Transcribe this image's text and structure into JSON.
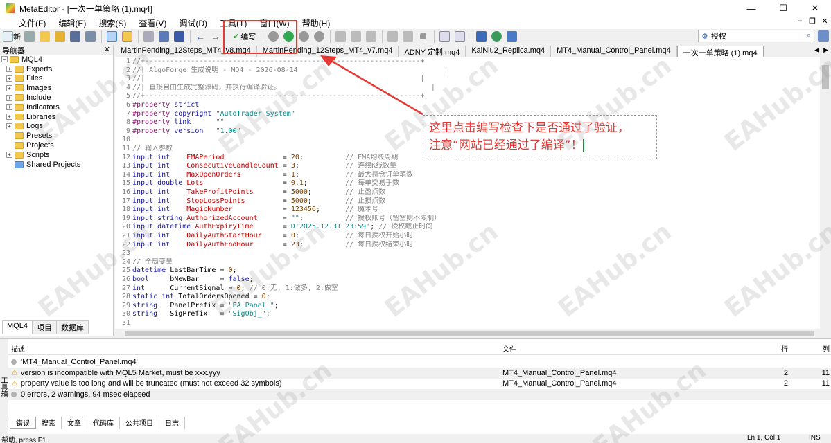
{
  "window": {
    "title": "MetaEditor - [一次一单策略 (1).mq4]",
    "minimize": "—",
    "maximize": "☐",
    "close": "✕"
  },
  "menu": {
    "items": [
      "文件(F)",
      "编辑(E)",
      "搜索(S)",
      "查看(V)",
      "调试(D)",
      "工具(T)",
      "窗口(W)",
      "帮助(H)"
    ]
  },
  "toolbar": {
    "new_label": "新",
    "compile_label": "编写",
    "search_value": "授权"
  },
  "navigator": {
    "title": "导航器",
    "root": "MQL4",
    "items": [
      {
        "label": "Experts",
        "expandable": true
      },
      {
        "label": "Files",
        "expandable": true
      },
      {
        "label": "Images",
        "expandable": true
      },
      {
        "label": "Include",
        "expandable": true
      },
      {
        "label": "Indicators",
        "expandable": true
      },
      {
        "label": "Libraries",
        "expandable": true
      },
      {
        "label": "Logs",
        "expandable": true
      },
      {
        "label": "Presets",
        "expandable": false
      },
      {
        "label": "Projects",
        "expandable": false
      },
      {
        "label": "Scripts",
        "expandable": true
      },
      {
        "label": "Shared Projects",
        "expandable": false
      }
    ],
    "tabs": [
      "MQL4",
      "项目",
      "数据库"
    ]
  },
  "editor_tabs": [
    {
      "label": "MartinPending_12Steps_MT4_v8.mq4",
      "active": false
    },
    {
      "label": "MartinPending_12Steps_MT4_v7.mq4",
      "active": false
    },
    {
      "label": "ADNY 定制.mq4",
      "active": false
    },
    {
      "label": "KaiNiu2_Replica.mq4",
      "active": false
    },
    {
      "label": "MT4_Manual_Control_Panel.mq4",
      "active": false
    },
    {
      "label": "一次一单策略 (1).mq4",
      "active": true
    }
  ],
  "code_lines": [
    [
      [
        "c-comment",
        "//+------------------------------------------------------------------+"
      ]
    ],
    [
      [
        "c-comment",
        "//| AlgoForge 生成说明 - MQ4 - 2026-08-14                                   |"
      ]
    ],
    [
      [
        "c-comment",
        "//|                                                                  |"
      ]
    ],
    [
      [
        "c-comment",
        "//| 直接自由生成完整源码，并执行编译验证。                                    |"
      ]
    ],
    [
      [
        "c-comment",
        "//+------------------------------------------------------------------+"
      ]
    ],
    [
      [
        "c-pp",
        "#property "
      ],
      [
        "c-kw",
        "strict"
      ]
    ],
    [
      [
        "c-pp",
        "#property "
      ],
      [
        "c-kw",
        "copyright "
      ],
      [
        "c-str",
        "\"AutoTrader System\""
      ]
    ],
    [
      [
        "c-pp",
        "#property "
      ],
      [
        "c-kw",
        "link      "
      ],
      [
        "c-str",
        "\"\""
      ]
    ],
    [
      [
        "c-pp",
        "#property "
      ],
      [
        "c-kw",
        "version   "
      ],
      [
        "c-str",
        "\"1.00\""
      ]
    ],
    [
      [
        "c-plain",
        ""
      ]
    ],
    [
      [
        "c-comment",
        "// 输入参数"
      ]
    ],
    [
      [
        "c-kw",
        "input int    "
      ],
      [
        "c-ident",
        "EMAPeriod              "
      ],
      [
        "c-plain",
        "= "
      ],
      [
        "c-num",
        "20"
      ],
      [
        "c-plain",
        ";          "
      ],
      [
        "c-comment",
        "// EMA均线周期"
      ]
    ],
    [
      [
        "c-kw",
        "input int    "
      ],
      [
        "c-ident",
        "ConsecutiveCandleCount "
      ],
      [
        "c-plain",
        "= "
      ],
      [
        "c-num",
        "3"
      ],
      [
        "c-plain",
        ";           "
      ],
      [
        "c-comment",
        "// 连续K线数量"
      ]
    ],
    [
      [
        "c-kw",
        "input int    "
      ],
      [
        "c-ident",
        "MaxOpenOrders          "
      ],
      [
        "c-plain",
        "= "
      ],
      [
        "c-num",
        "1"
      ],
      [
        "c-plain",
        ";           "
      ],
      [
        "c-comment",
        "// 最大持仓订单笔数"
      ]
    ],
    [
      [
        "c-kw",
        "input double "
      ],
      [
        "c-ident",
        "Lots                   "
      ],
      [
        "c-plain",
        "= "
      ],
      [
        "c-num",
        "0.1"
      ],
      [
        "c-plain",
        ";         "
      ],
      [
        "c-comment",
        "// 每单交易手数"
      ]
    ],
    [
      [
        "c-kw",
        "input int    "
      ],
      [
        "c-ident",
        "TakeProfitPoints       "
      ],
      [
        "c-plain",
        "= "
      ],
      [
        "c-num",
        "5000"
      ],
      [
        "c-plain",
        ";        "
      ],
      [
        "c-comment",
        "// 止盈点数"
      ]
    ],
    [
      [
        "c-kw",
        "input int    "
      ],
      [
        "c-ident",
        "StopLossPoints         "
      ],
      [
        "c-plain",
        "= "
      ],
      [
        "c-num",
        "5000"
      ],
      [
        "c-plain",
        ";        "
      ],
      [
        "c-comment",
        "// 止损点数"
      ]
    ],
    [
      [
        "c-kw",
        "input int    "
      ],
      [
        "c-ident",
        "MagicNumber            "
      ],
      [
        "c-plain",
        "= "
      ],
      [
        "c-num",
        "123456"
      ],
      [
        "c-plain",
        ";      "
      ],
      [
        "c-comment",
        "// 魔术号"
      ]
    ],
    [
      [
        "c-kw",
        "input string "
      ],
      [
        "c-ident",
        "AuthorizedAccount      "
      ],
      [
        "c-plain",
        "= "
      ],
      [
        "c-str",
        "\"\""
      ],
      [
        "c-plain",
        ";          "
      ],
      [
        "c-comment",
        "// 授权账号（留空则不限制）"
      ]
    ],
    [
      [
        "c-kw",
        "input datetime "
      ],
      [
        "c-ident",
        "AuthExpiryTime       "
      ],
      [
        "c-plain",
        "= "
      ],
      [
        "c-str",
        "D'2025.12.31 23:59'"
      ],
      [
        "c-plain",
        "; "
      ],
      [
        "c-comment",
        "// 授权截止时间"
      ]
    ],
    [
      [
        "c-kw",
        "input int    "
      ],
      [
        "c-ident",
        "DailyAuthStartHour     "
      ],
      [
        "c-plain",
        "= "
      ],
      [
        "c-num",
        "0"
      ],
      [
        "c-plain",
        ";           "
      ],
      [
        "c-comment",
        "// 每日授权开始小时"
      ]
    ],
    [
      [
        "c-kw",
        "input int    "
      ],
      [
        "c-ident",
        "DailyAuthEndHour       "
      ],
      [
        "c-plain",
        "= "
      ],
      [
        "c-num",
        "23"
      ],
      [
        "c-plain",
        ";          "
      ],
      [
        "c-comment",
        "// 每日授权结束小时"
      ]
    ],
    [
      [
        "c-plain",
        ""
      ]
    ],
    [
      [
        "c-comment",
        "// 全局变量"
      ]
    ],
    [
      [
        "c-kw",
        "datetime "
      ],
      [
        "c-plain",
        "LastBarTime = "
      ],
      [
        "c-num",
        "0"
      ],
      [
        "c-plain",
        ";"
      ]
    ],
    [
      [
        "c-kw",
        "bool     "
      ],
      [
        "c-plain",
        "bNewBar     = "
      ],
      [
        "c-kw",
        "false"
      ],
      [
        "c-plain",
        ";"
      ]
    ],
    [
      [
        "c-kw",
        "int      "
      ],
      [
        "c-plain",
        "CurrentSignal = "
      ],
      [
        "c-num",
        "0"
      ],
      [
        "c-plain",
        "; "
      ],
      [
        "c-comment",
        "// 0:无, 1:做多, 2:做空"
      ]
    ],
    [
      [
        "c-kw",
        "static int "
      ],
      [
        "c-plain",
        "TotalOrdersOpened = "
      ],
      [
        "c-num",
        "0"
      ],
      [
        "c-plain",
        ";"
      ]
    ],
    [
      [
        "c-kw",
        "string   "
      ],
      [
        "c-plain",
        "PanelPrefix = "
      ],
      [
        "c-str",
        "\"EA_Panel_\""
      ],
      [
        "c-plain",
        ";"
      ]
    ],
    [
      [
        "c-kw",
        "string   "
      ],
      [
        "c-plain",
        "SigPrefix   = "
      ],
      [
        "c-str",
        "\"SigObj_\""
      ],
      [
        "c-plain",
        ";"
      ]
    ],
    [
      [
        "c-plain",
        ""
      ]
    ]
  ],
  "annotation": {
    "line1": "这里点击编写检查下是否通过了验证，",
    "line2": "注意“网站已经通过了编译”！"
  },
  "errors": {
    "headers": {
      "description": "描述",
      "file": "文件",
      "line": "行",
      "column": "列"
    },
    "rows": [
      {
        "type": "info",
        "description": "'MT4_Manual_Control_Panel.mq4'",
        "file": "",
        "line": "",
        "column": ""
      },
      {
        "type": "warning",
        "description": "version is incompatible with MQL5 Market, must be xxx.yyy",
        "file": "MT4_Manual_Control_Panel.mq4",
        "line": "2",
        "column": "11"
      },
      {
        "type": "warning",
        "description": "property value is too long and will be truncated (must not exceed 32 symbols)",
        "file": "MT4_Manual_Control_Panel.mq4",
        "line": "2",
        "column": "11"
      },
      {
        "type": "info",
        "description": "0 errors, 2 warnings, 94 msec elapsed",
        "file": "",
        "line": "",
        "column": ""
      }
    ],
    "tabs": [
      "错误",
      "搜索",
      "文章",
      "代码库",
      "公共项目",
      "日志"
    ],
    "side_label": "工具箱"
  },
  "status": {
    "help": "帮助, press F1",
    "position": "Ln 1, Col 1",
    "mode": "INS"
  },
  "watermark": "EAHub.cn",
  "colors": {
    "annotation_red": "#e53935",
    "warning_yellow": "#d9a200"
  }
}
